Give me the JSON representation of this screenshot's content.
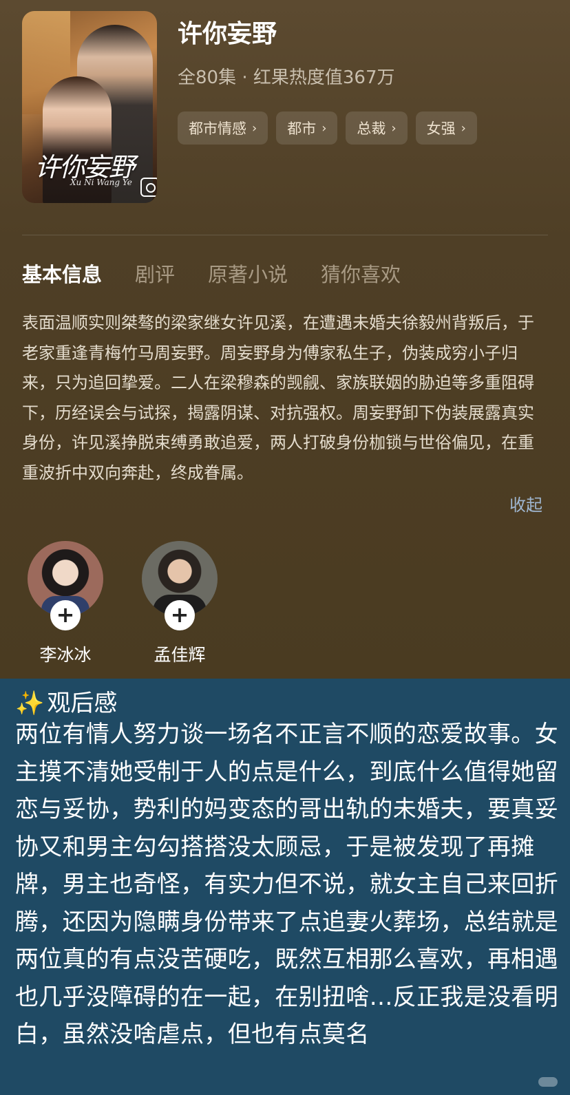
{
  "show": {
    "title": "许你妄野",
    "meta": "全80集 · 红果热度值367万",
    "tags": [
      "都市情感",
      "都市",
      "总裁",
      "女强"
    ],
    "poster_title": "许你妄野",
    "poster_subtitle": "Xu Ni Wang Ye"
  },
  "tabs": [
    "基本信息",
    "剧评",
    "原著小说",
    "猜你喜欢"
  ],
  "synopsis": "表面温顺实则桀骜的梁家继女许见溪，在遭遇未婚夫徐毅州背叛后，于老家重逢青梅竹马周妄野。周妄野身为傅家私生子，伪装成穷小子归来，只为追回挚爱。二人在梁穆森的觊觎、家族联姻的胁迫等多重阻碍下，历经误会与试探，揭露阴谋、对抗强权。周妄野卸下伪装展露真实身份，许见溪挣脱束缚勇敢追爱，两人打破身份枷锁与世俗偏见，在重重波折中双向奔赴，终成眷属。",
  "collapse_label": "收起",
  "cast": [
    {
      "name": "李冰冰",
      "follow": "+"
    },
    {
      "name": "孟佳辉",
      "follow": "+"
    }
  ],
  "review": {
    "spark": "✨",
    "title": "观后感",
    "body": "两位有情人努力谈一场名不正言不顺的恋爱故事。女主摸不清她受制于人的点是什么，到底什么值得她留恋与妥协，势利的妈变态的哥出轨的未婚夫，要真妥协又和男主勾勾搭搭没太顾忌，于是被发现了再摊牌，男主也奇怪，有实力但不说，就女主自己来回折腾，还因为隐瞒身份带来了点追妻火葬场，总结就是两位真的有点没苦硬吃，既然互相那么喜欢，再相遇也几乎没障碍的在一起，在别扭啥…反正我是没看明白，虽然没啥虐点，但也有点莫名"
  },
  "colors": {
    "top_bg": "#4f3f26",
    "review_bg": "#1f4a64",
    "link": "#9fb6d0"
  }
}
